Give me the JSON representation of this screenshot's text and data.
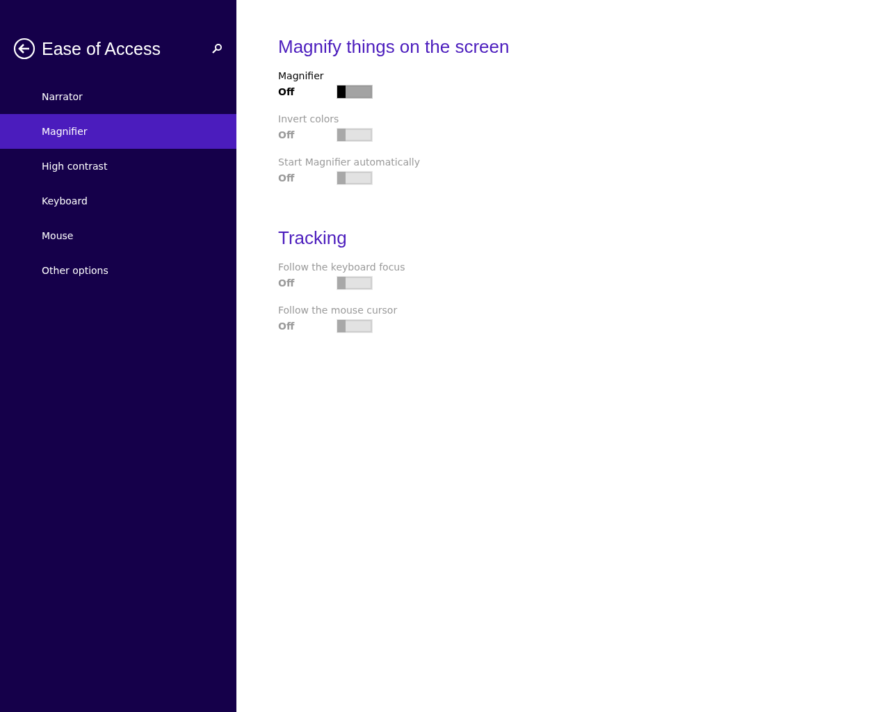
{
  "sidebar": {
    "title": "Ease of Access",
    "items": [
      {
        "label": "Narrator",
        "selected": false
      },
      {
        "label": "Magnifier",
        "selected": true
      },
      {
        "label": "High contrast",
        "selected": false
      },
      {
        "label": "Keyboard",
        "selected": false
      },
      {
        "label": "Mouse",
        "selected": false
      },
      {
        "label": "Other options",
        "selected": false
      }
    ]
  },
  "sections": [
    {
      "heading": "Magnify things on the screen",
      "settings": [
        {
          "label": "Magnifier",
          "state": "Off",
          "on": false,
          "disabled": false
        },
        {
          "label": "Invert colors",
          "state": "Off",
          "on": false,
          "disabled": true
        },
        {
          "label": "Start Magnifier automatically",
          "state": "Off",
          "on": false,
          "disabled": true
        }
      ]
    },
    {
      "heading": "Tracking",
      "settings": [
        {
          "label": "Follow the keyboard focus",
          "state": "Off",
          "on": false,
          "disabled": true
        },
        {
          "label": "Follow the mouse cursor",
          "state": "Off",
          "on": false,
          "disabled": true
        }
      ]
    }
  ]
}
